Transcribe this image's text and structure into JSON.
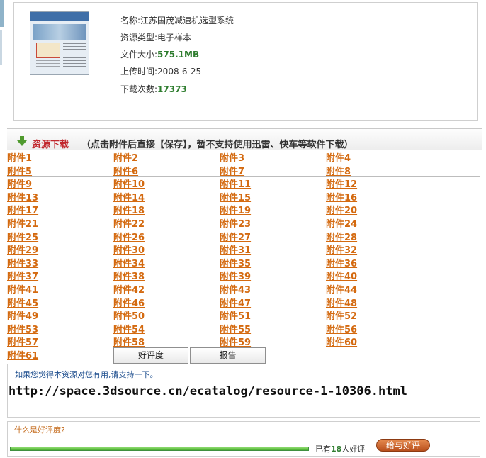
{
  "resource": {
    "name_label": "名称:",
    "name": "江苏国茂减速机选型系统",
    "type_label": "资源类型:",
    "type": "电子样本",
    "size_label": "文件大小:",
    "size": "575.1MB",
    "upload_label": "上传时间:",
    "upload_date": "2008-6-25",
    "downloads_label": "下载次数:",
    "downloads": "17373",
    "thumbnail_icon": "catalog-thumbnail"
  },
  "download": {
    "title": "资源下载",
    "note": "（点击附件后直接【保存】，暂不支持使用迅雷、快车等软件下载）",
    "attachments": [
      "附件1",
      "附件2",
      "附件3",
      "附件4",
      "附件5",
      "附件6",
      "附件7",
      "附件8",
      "附件9",
      "附件10",
      "附件11",
      "附件12",
      "附件13",
      "附件14",
      "附件15",
      "附件16",
      "附件17",
      "附件18",
      "附件19",
      "附件20",
      "附件21",
      "附件22",
      "附件23",
      "附件24",
      "附件25",
      "附件26",
      "附件27",
      "附件28",
      "附件29",
      "附件30",
      "附件31",
      "附件32",
      "附件33",
      "附件34",
      "附件35",
      "附件36",
      "附件37",
      "附件38",
      "附件39",
      "附件40",
      "附件41",
      "附件42",
      "附件43",
      "附件44",
      "附件45",
      "附件46",
      "附件47",
      "附件48",
      "附件49",
      "附件50",
      "附件51",
      "附件52",
      "附件53",
      "附件54",
      "附件55",
      "附件56",
      "附件57",
      "附件58",
      "附件59",
      "附件60",
      "附件61"
    ]
  },
  "tabs": {
    "rating": "好评度",
    "report": "报告"
  },
  "rating": {
    "message": "如果您觉得本资源对您有用,请支持一下。",
    "url": "http://space.3dsource.cn/ecatalog/resource-1-10306.html",
    "what_is": "什么是好评度?",
    "progress": 1.0,
    "count_prefix": "已有",
    "count": "18",
    "count_suffix": "人好评",
    "give_button": "给与好评"
  },
  "colors": {
    "accent_red": "#c1272d",
    "attachment_orange": "#d46a10",
    "count_green": "#2f7d2f"
  }
}
